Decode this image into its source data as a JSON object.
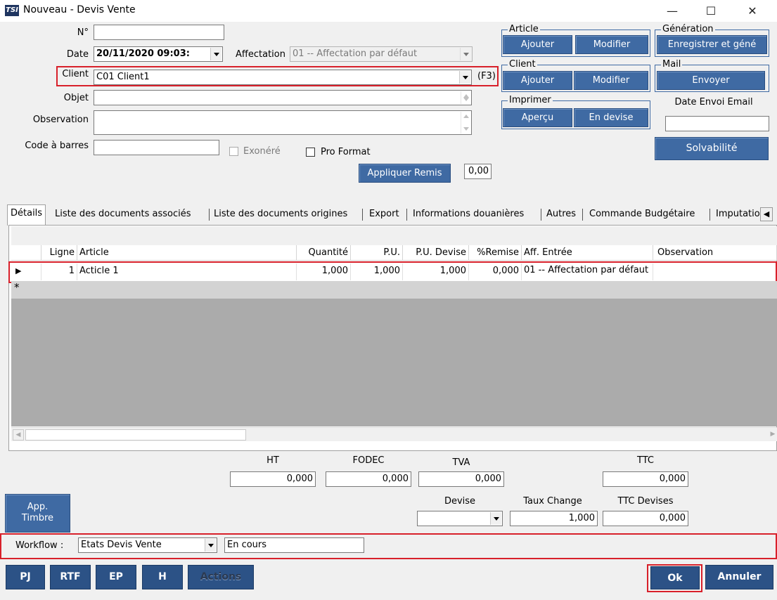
{
  "window": {
    "icon_text": "TSI",
    "title": "Nouveau - Devis Vente",
    "minimize": "—",
    "maximize": "☐",
    "close": "✕"
  },
  "form": {
    "no_label": "N°",
    "no_value": "",
    "date_label": "Date",
    "date_value": "20/11/2020 09:03:",
    "affectation_label": "Affectation",
    "affectation_value": "01 -- Affectation par défaut",
    "client_label": "Client",
    "client_value": "C01 Client1",
    "client_hotkey": "(F3)",
    "objet_label": "Objet",
    "objet_value": "",
    "observation_label": "Observation",
    "observation_value": "",
    "barcode_label": "Code à barres",
    "barcode_value": "",
    "exonere_label": "Exonéré",
    "proformat_label": "Pro Format",
    "appliquer_remis_label": "Appliquer Remis",
    "remis_value": "0,00"
  },
  "groups": {
    "article": {
      "legend": "Article",
      "add": "Ajouter",
      "edit": "Modifier"
    },
    "client": {
      "legend": "Client",
      "add": "Ajouter",
      "edit": "Modifier"
    },
    "imprimer": {
      "legend": "Imprimer",
      "preview": "Aperçu",
      "currency": "En devise"
    },
    "generation": {
      "legend": "Génération",
      "save_gen": "Enregistrer et géné"
    },
    "mail": {
      "legend": "Mail",
      "send": "Envoyer"
    },
    "date_envoi_label": "Date Envoi Email",
    "date_envoi_value": "",
    "solvabilite": "Solvabilité"
  },
  "tabs": [
    "Détails",
    "Liste des documents associés",
    "Liste des documents origines",
    "Export",
    "Informations douanières",
    "Autres",
    "Commande Budgétaire",
    "Imputatio"
  ],
  "grid": {
    "columns": [
      "Ligne",
      "Article",
      "Quantité",
      "P.U.",
      "P.U. Devise",
      "%Remise",
      "Aff. Entrée",
      "Observation"
    ],
    "rows": [
      {
        "indicator": "▶",
        "ligne": "1",
        "article": "Acticle 1",
        "quantite": "1,000",
        "pu": "1,000",
        "pu_devise": "1,000",
        "remise": "0,000",
        "aff": "01 -- Affectation par défaut",
        "observation": ""
      }
    ],
    "new_row_marker": "*"
  },
  "totals": {
    "ht_label": "HT",
    "ht": "0,000",
    "fodec_label": "FODEC",
    "fodec": "0,000",
    "tva_label": "TVA",
    "tva": "0,000",
    "ttc_label": "TTC",
    "ttc": "0,000",
    "devise_label": "Devise",
    "devise": "",
    "taux_label": "Taux Change",
    "taux": "1,000",
    "ttc_devises_label": "TTC Devises",
    "ttc_devises": "0,000"
  },
  "app_timbre": {
    "line1": "App.",
    "line2": "Timbre"
  },
  "workflow": {
    "label": "Workflow :",
    "selected": "Etats Devis Vente",
    "status": "En cours"
  },
  "bottom": {
    "pj": "PJ",
    "rtf": "RTF",
    "ep": "EP",
    "h": "H",
    "actions": "Actions",
    "ok": "Ok",
    "cancel": "Annuler"
  },
  "colors": {
    "button_blue": "#3f6aa3",
    "button_dark": "#2c5286",
    "highlight_red": "#d8202a"
  }
}
